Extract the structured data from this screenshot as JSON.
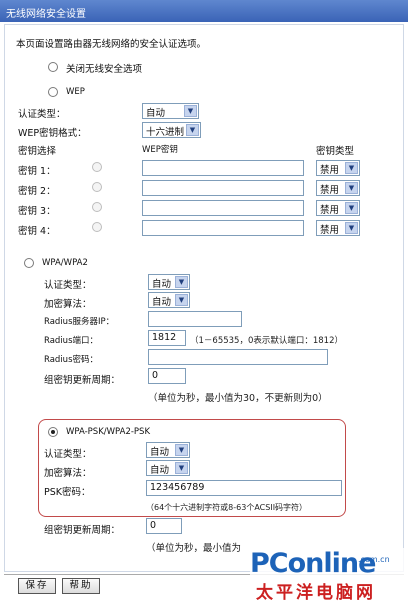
{
  "window": {
    "title": "无线网络安全设置"
  },
  "intro": "本页面设置路由器无线网络的安全认证选项。",
  "disable_option": "关闭无线安全选项",
  "wep": {
    "title": "WEP",
    "auth_label": "认证类型：",
    "auth_value": "自动",
    "format_label": "WEP密钥格式：",
    "format_value": "十六进制",
    "col_select": "密钥选择",
    "col_key": "WEP密钥",
    "col_type": "密钥类型",
    "keys": [
      {
        "label": "密钥 1：",
        "value": "",
        "type": "禁用"
      },
      {
        "label": "密钥 2：",
        "value": "",
        "type": "禁用"
      },
      {
        "label": "密钥 3：",
        "value": "",
        "type": "禁用"
      },
      {
        "label": "密钥 4：",
        "value": "",
        "type": "禁用"
      }
    ]
  },
  "wpa": {
    "title": "WPA/WPA2",
    "auth_label": "认证类型：",
    "auth_value": "自动",
    "alg_label": "加密算法：",
    "alg_value": "自动",
    "radius_ip_label": "Radius服务器IP：",
    "radius_ip_value": "",
    "radius_port_label": "Radius端口：",
    "radius_port_value": "1812",
    "radius_port_hint": "（1－65535，0表示默认端口：1812）",
    "radius_pwd_label": "Radius密码：",
    "radius_pwd_value": "",
    "group_label": "组密钥更新周期：",
    "group_value": "0",
    "group_hint": "（单位为秒，最小值为30，不更新则为0）"
  },
  "psk": {
    "title": "WPA-PSK/WPA2-PSK",
    "auth_label": "认证类型：",
    "auth_value": "自动",
    "alg_label": "加密算法：",
    "alg_value": "自动",
    "pwd_label": "PSK密码：",
    "pwd_value": "123456789",
    "pwd_hint": "（64个十六进制字符或8-63个ACSII码字符）",
    "group_label": "组密钥更新周期：",
    "group_value": "0",
    "group_hint": "（单位为秒，最小值为"
  },
  "buttons": {
    "save": "保存",
    "help": "帮助"
  },
  "watermark": {
    "logo": "PConline",
    "domain": ".com.cn",
    "cn": "太平洋电脑网"
  },
  "icons": {
    "dropdown": "chevron-down-icon"
  },
  "colors": {
    "titlebar": "#3a63b6",
    "highlight_border": "#c24a4a",
    "watermark_blue": "#1d63b8",
    "watermark_red": "#cc2020"
  }
}
